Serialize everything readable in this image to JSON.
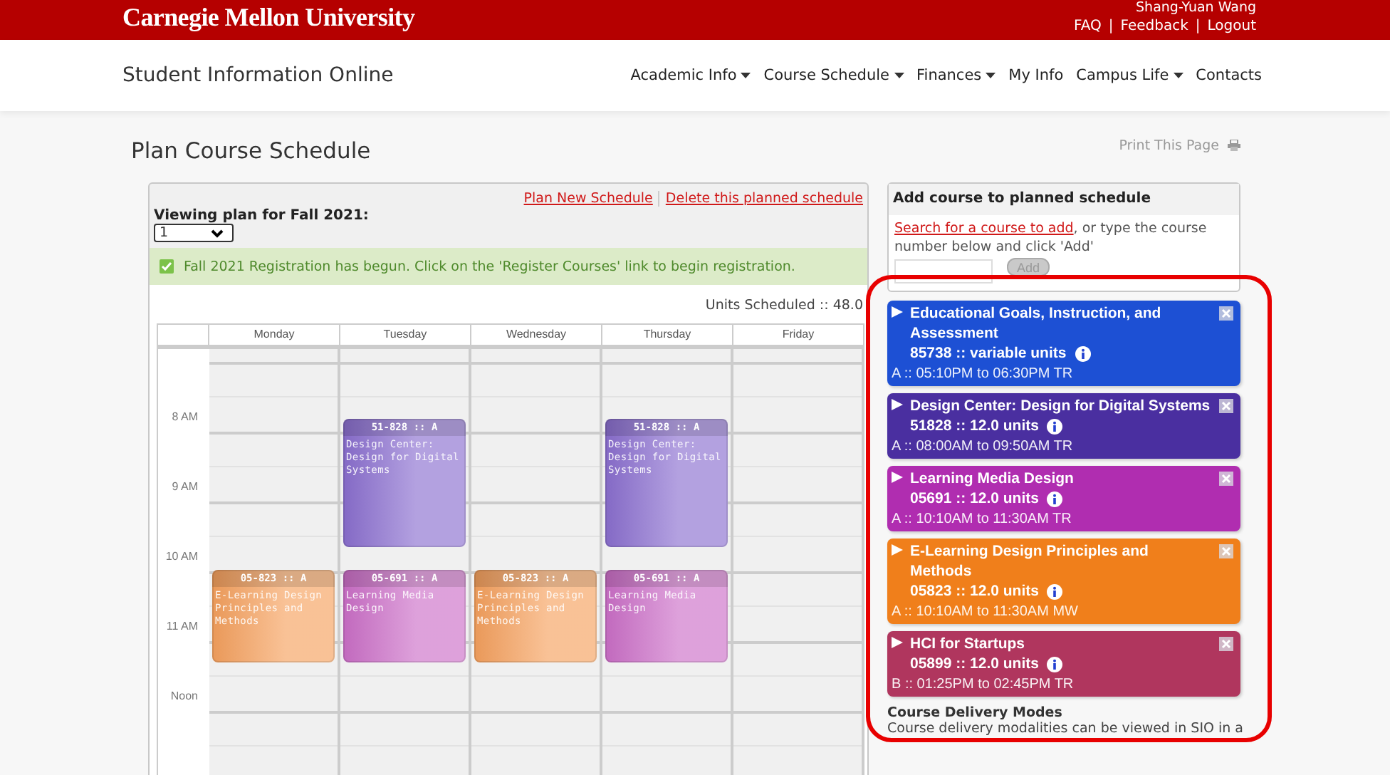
{
  "header": {
    "logo": "Carnegie Mellon University",
    "user": "Shang-Yuan Wang",
    "links": [
      "FAQ",
      "Feedback",
      "Logout"
    ],
    "separators": [
      "|",
      "|"
    ]
  },
  "navbar": {
    "brand": "Student Information Online",
    "items": [
      {
        "label": "Academic Info",
        "dropdown": true
      },
      {
        "label": "Course Schedule",
        "dropdown": true
      },
      {
        "label": "Finances",
        "dropdown": true
      },
      {
        "label": "My Info",
        "dropdown": false
      },
      {
        "label": "Campus Life",
        "dropdown": true
      },
      {
        "label": "Contacts",
        "dropdown": false
      }
    ]
  },
  "page": {
    "title": "Plan Course Schedule",
    "print_link": "Print This Page"
  },
  "plan": {
    "actions": [
      "Plan New Schedule",
      "Delete this planned schedule"
    ],
    "viewing_label": "Viewing plan for Fall 2021:",
    "plan_select": "1",
    "alert": "Fall 2021 Registration has begun. Click on the 'Register Courses' link to begin registration.",
    "units_scheduled": "Units Scheduled :: 48.0"
  },
  "calendar": {
    "time_labels": [
      "8 AM",
      "9 AM",
      "10 AM",
      "11 AM",
      "Noon"
    ],
    "days": [
      {
        "label": "Monday",
        "events": [
          {
            "kind": "midmorning",
            "code": "05-823 :: A",
            "title": "E-Learning Design Principles and Methods",
            "color": "#f6a15e"
          }
        ]
      },
      {
        "label": "Tuesday",
        "events": [
          {
            "kind": "early",
            "code": "51-828 :: A",
            "title": "Design Center: Design for Digital Systems",
            "color": "#8b6fd0"
          },
          {
            "kind": "midmorning",
            "code": "05-691 :: A",
            "title": "Learning Media Design",
            "color": "#cc6fc8"
          }
        ]
      },
      {
        "label": "Wednesday",
        "events": [
          {
            "kind": "midmorning",
            "code": "05-823 :: A",
            "title": "E-Learning Design Principles and Methods",
            "color": "#f6a15e"
          }
        ]
      },
      {
        "label": "Thursday",
        "events": [
          {
            "kind": "early",
            "code": "51-828 :: A",
            "title": "Design Center: Design for Digital Systems",
            "color": "#8b6fd0"
          },
          {
            "kind": "midmorning",
            "code": "05-691 :: A",
            "title": "Learning Media Design",
            "color": "#cc6fc8"
          }
        ]
      },
      {
        "label": "Friday"
      }
    ]
  },
  "add_course": {
    "title": "Add course to planned schedule",
    "search_link": "Search for a course to add",
    "instructions": ", or type the course number below and click 'Add'",
    "button": "Add"
  },
  "courses": [
    {
      "title": "Educational Goals, Instruction, and Assessment",
      "units": "85738 :: variable units",
      "section": "A :: 05:10PM to 06:30PM TR",
      "color": "#1d50d4"
    },
    {
      "title": "Design Center: Design for Digital Systems",
      "units": "51828 :: 12.0 units",
      "section": "A :: 08:00AM to 09:50AM TR",
      "color": "#4a2fa0"
    },
    {
      "title": "Learning Media Design",
      "units": "05691 :: 12.0 units",
      "section": "A :: 10:10AM to 11:30AM TR",
      "color": "#b02db0"
    },
    {
      "title": "E-Learning Design Principles and Methods",
      "units": "05823 :: 12.0 units",
      "section": "A :: 10:10AM to 11:30AM MW",
      "color": "#f07f1b"
    },
    {
      "title": "HCI for Startups",
      "units": "05899 :: 12.0 units",
      "section": "B :: 01:25PM to 02:45PM TR",
      "color": "#b0365e"
    }
  ],
  "delivery": {
    "heading": "Course Delivery Modes",
    "text": "Course delivery modalities can be viewed in SIO in a"
  }
}
